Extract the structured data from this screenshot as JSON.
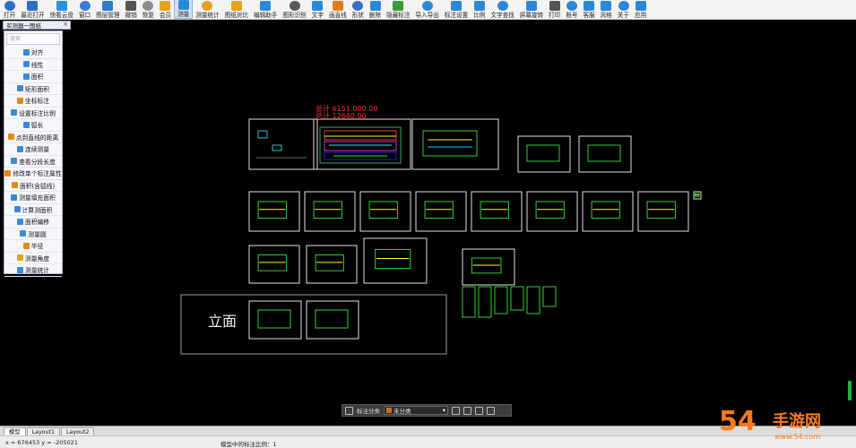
{
  "toolbar": {
    "items": [
      {
        "label": "打开",
        "color": "#2c6fc1",
        "name": "open"
      },
      {
        "label": "最近打开",
        "color": "#2c6fc1",
        "name": "recent"
      },
      {
        "label": "快看云盘",
        "color": "#2e8fd8",
        "name": "cloud"
      },
      {
        "label": "窗口",
        "color": "#3d7bd6",
        "name": "window"
      },
      {
        "label": "图层管理",
        "color": "#2b7bcc",
        "name": "layers"
      },
      {
        "label": "撤销",
        "color": "#555555",
        "name": "undo"
      },
      {
        "label": "恢复",
        "color": "#8c8c8c",
        "name": "redo"
      },
      {
        "label": "会员",
        "color": "#e2a21c",
        "name": "vip"
      },
      {
        "label": "测量",
        "color": "#2b88d8",
        "name": "measure",
        "active": true
      },
      {
        "label": "测量统计",
        "color": "#e0a21c",
        "name": "stats"
      },
      {
        "label": "图纸对比",
        "color": "#e2a21c",
        "name": "compare"
      },
      {
        "label": "编辑助手",
        "color": "#2b88d8",
        "name": "edit"
      },
      {
        "label": "图形识别",
        "color": "#5a5a5a",
        "name": "recognize"
      },
      {
        "label": "文字",
        "color": "#2b88d8",
        "name": "text"
      },
      {
        "label": "画直线",
        "color": "#e07b1c",
        "name": "line"
      },
      {
        "label": "形状",
        "color": "#3a6fc8",
        "name": "shape"
      },
      {
        "label": "删除",
        "color": "#2b88d8",
        "name": "delete"
      },
      {
        "label": "隐藏标注",
        "color": "#3a9a3a",
        "name": "hide"
      },
      {
        "label": "导入导出",
        "color": "#2b88d8",
        "name": "import"
      },
      {
        "label": "标注设置",
        "color": "#2b88d8",
        "name": "settings"
      },
      {
        "label": "比例",
        "color": "#2b88d8",
        "name": "scale"
      },
      {
        "label": "文字查找",
        "color": "#2b88d8",
        "name": "find"
      },
      {
        "label": "屏幕旋转",
        "color": "#2b88d8",
        "name": "rotate"
      },
      {
        "label": "打印",
        "color": "#555555",
        "name": "print"
      },
      {
        "label": "账号",
        "color": "#2b88d8",
        "name": "account"
      },
      {
        "label": "客服",
        "color": "#2b88d8",
        "name": "service"
      },
      {
        "label": "风格",
        "color": "#2b88d8",
        "name": "style"
      },
      {
        "label": "关于",
        "color": "#2b88d8",
        "name": "about"
      },
      {
        "label": "应用",
        "color": "#2b88d8",
        "name": "apps"
      }
    ]
  },
  "doc_tab": {
    "label": "买测器一图纸",
    "close": "×"
  },
  "side_panel": {
    "search_placeholder": "搜索",
    "items": [
      {
        "label": "对齐",
        "color": "#3b8ad8"
      },
      {
        "label": "线性",
        "color": "#3b8ad8"
      },
      {
        "label": "面积",
        "color": "#3b8ad8"
      },
      {
        "label": "矩形面积",
        "color": "#3b8ad8"
      },
      {
        "label": "坐标标注",
        "color": "#e08a1c"
      },
      {
        "label": "设置标注比例",
        "color": "#3b8ad8"
      },
      {
        "label": "弧长",
        "color": "#3b8ad8"
      },
      {
        "label": "点到直线的距离",
        "color": "#e08a1c"
      },
      {
        "label": "连续测量",
        "color": "#3b8ad8"
      },
      {
        "label": "查看分段长度",
        "color": "#3b8ad8"
      },
      {
        "label": "修改单个标注属性",
        "color": "#e08a1c"
      },
      {
        "label": "面积(含弧线)",
        "color": "#e08a1c"
      },
      {
        "label": "测量填充面积",
        "color": "#3b8ad8"
      },
      {
        "label": "计算测面积",
        "color": "#3b8ad8"
      },
      {
        "label": "面积编移",
        "color": "#3b8ad8"
      },
      {
        "label": "测量圆",
        "color": "#3b8ad8"
      },
      {
        "label": "半径",
        "color": "#e08a1c"
      },
      {
        "label": "测量角度",
        "color": "#e0a21c"
      },
      {
        "label": "测量统计",
        "color": "#3b8ad8"
      }
    ]
  },
  "drawing": {
    "red_title_1": "总计 6151.000.00",
    "red_title_2": "总计 12640.00",
    "big_text": "立面"
  },
  "float_bar": {
    "label": "标注分类",
    "selected": "未分类",
    "swatch_color": "#d46a1f"
  },
  "layout_tabs": [
    {
      "label": "模型",
      "active": true
    },
    {
      "label": "Layout1",
      "active": false
    },
    {
      "label": "Layout2",
      "active": false
    }
  ],
  "status": {
    "coords": "x = 676453  y = -205021",
    "scale_text": "模型中的标注比例：1"
  },
  "watermark": {
    "text": "54秒手游网",
    "sub": "www.54.com"
  }
}
